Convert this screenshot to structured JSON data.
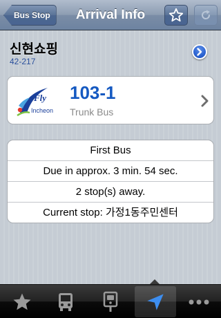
{
  "nav": {
    "back_label": "Bus Stop",
    "title": "Arrival Info",
    "favorite_icon": "star-icon",
    "refresh_icon": "refresh-icon"
  },
  "stop": {
    "name": "신현쇼핑",
    "id": "42-217",
    "detail_icon": "disclosure-arrow-icon"
  },
  "route": {
    "logo_text_top": "Fly",
    "logo_text_bottom": "Incheon",
    "number": "103-1",
    "type": "Trunk Bus"
  },
  "info": {
    "rows": [
      "First Bus",
      "Due in approx. 3 min. 54 sec.",
      "2 stop(s) away.",
      "Current stop: 가정1동주민센터"
    ]
  },
  "tabs": [
    {
      "icon": "star-icon",
      "selected": false
    },
    {
      "icon": "bus-icon",
      "selected": false
    },
    {
      "icon": "bus-stop-sign-icon",
      "selected": false
    },
    {
      "icon": "location-arrow-icon",
      "selected": true
    },
    {
      "icon": "more-icon",
      "selected": false
    }
  ],
  "colors": {
    "accent_blue": "#1559c1",
    "nav_bar": "#6d83a1",
    "background": "#c5ccd4"
  }
}
